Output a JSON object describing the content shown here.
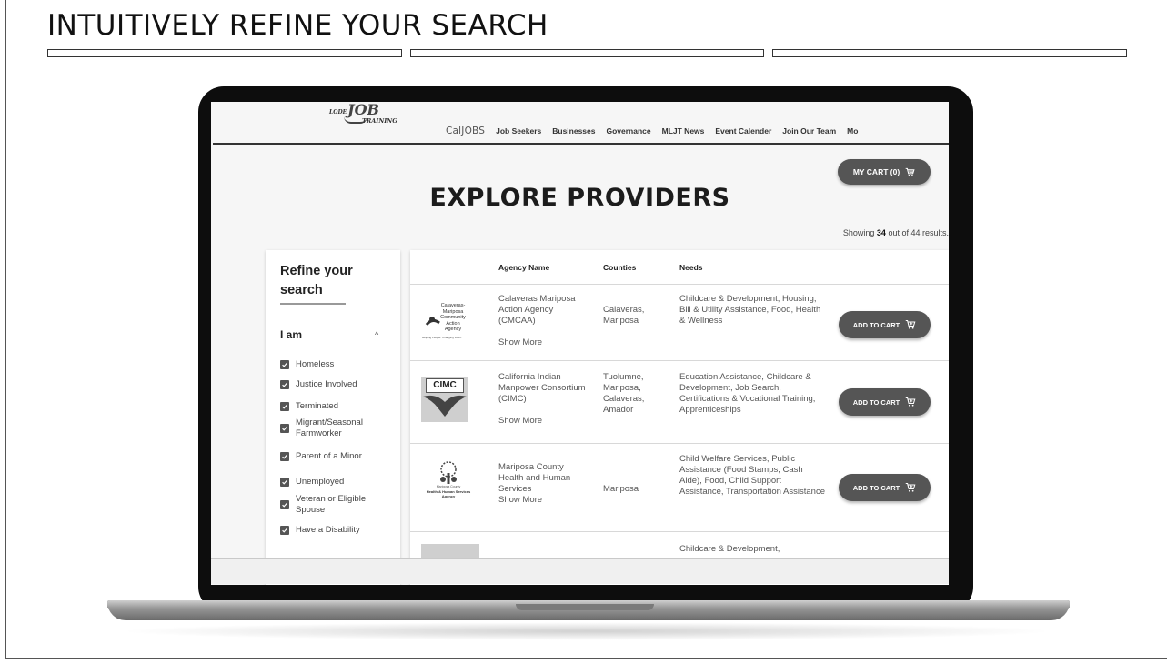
{
  "slide": {
    "title": "INTUITIVELY REFINE YOUR SEARCH"
  },
  "site": {
    "logo": {
      "top": "LODE",
      "main": "JOB",
      "sub": "TRAINING"
    },
    "nav": {
      "brand": "CalJOBS",
      "items": [
        "Job Seekers",
        "Businesses",
        "Governance",
        "MLJT News",
        "Event Calender",
        "Join Our Team",
        "Mo"
      ]
    },
    "cart_label": "MY CART (0)",
    "page_title": "EXPLORE PROVIDERS",
    "showing": {
      "prefix": "Showing",
      "count": "34",
      "suffix": "out of 44 results."
    }
  },
  "sidebar": {
    "title": "Refine your search",
    "group_label": "I am",
    "options": [
      {
        "label": "Homeless",
        "checked": true
      },
      {
        "label": "Justice Involved",
        "checked": true
      },
      {
        "label": "Terminated",
        "checked": true
      },
      {
        "label": "Migrant/Seasonal Farmworker",
        "checked": true
      },
      {
        "label": "Parent of a Minor",
        "checked": true
      },
      {
        "label": "Unemployed",
        "checked": true
      },
      {
        "label": "Veteran or Eligible Spouse",
        "checked": true
      },
      {
        "label": "Have a Disability",
        "checked": true
      }
    ]
  },
  "table": {
    "headers": {
      "agency": "Agency Name",
      "counties": "Counties",
      "needs": "Needs"
    },
    "add_label": "ADD TO CART",
    "rows": [
      {
        "logo_text": "Calaveras-Mariposa Community Action Agency",
        "logo_tag": "Helping People. Changing Lives.",
        "agency": "Calaveras Mariposa Action Agency (CMCAA)",
        "show_more": "Show More",
        "counties": "Calaveras, Mariposa",
        "needs": "Childcare & Development, Housing, Bill & Utility Assistance, Food, Health & Wellness"
      },
      {
        "logo_text": "CIMC",
        "agency": "California Indian Manpower Consortium (CIMC)",
        "show_more": "Show More",
        "counties": "Tuolumne, Mariposa, Calaveras, Amador",
        "needs": "Education Assistance, Childcare & Development, Job Search, Certifications & Vocational Training, Apprenticeships"
      },
      {
        "logo_text": "Mariposa County",
        "logo_tag": "Health & Human Services Agency",
        "agency": "Mariposa County Health and Human Services",
        "show_more": "Show More",
        "counties": "Mariposa",
        "needs": "Child Welfare Services, Public Assistance (Food Stamps, Cash Aide), Food, Child Support Assistance, Transportation Assistance"
      },
      {
        "needs": "Childcare & Development,"
      }
    ]
  },
  "colors": {
    "button": "#555555",
    "laptop_body": "#0d0d0d",
    "text": "#222222"
  }
}
